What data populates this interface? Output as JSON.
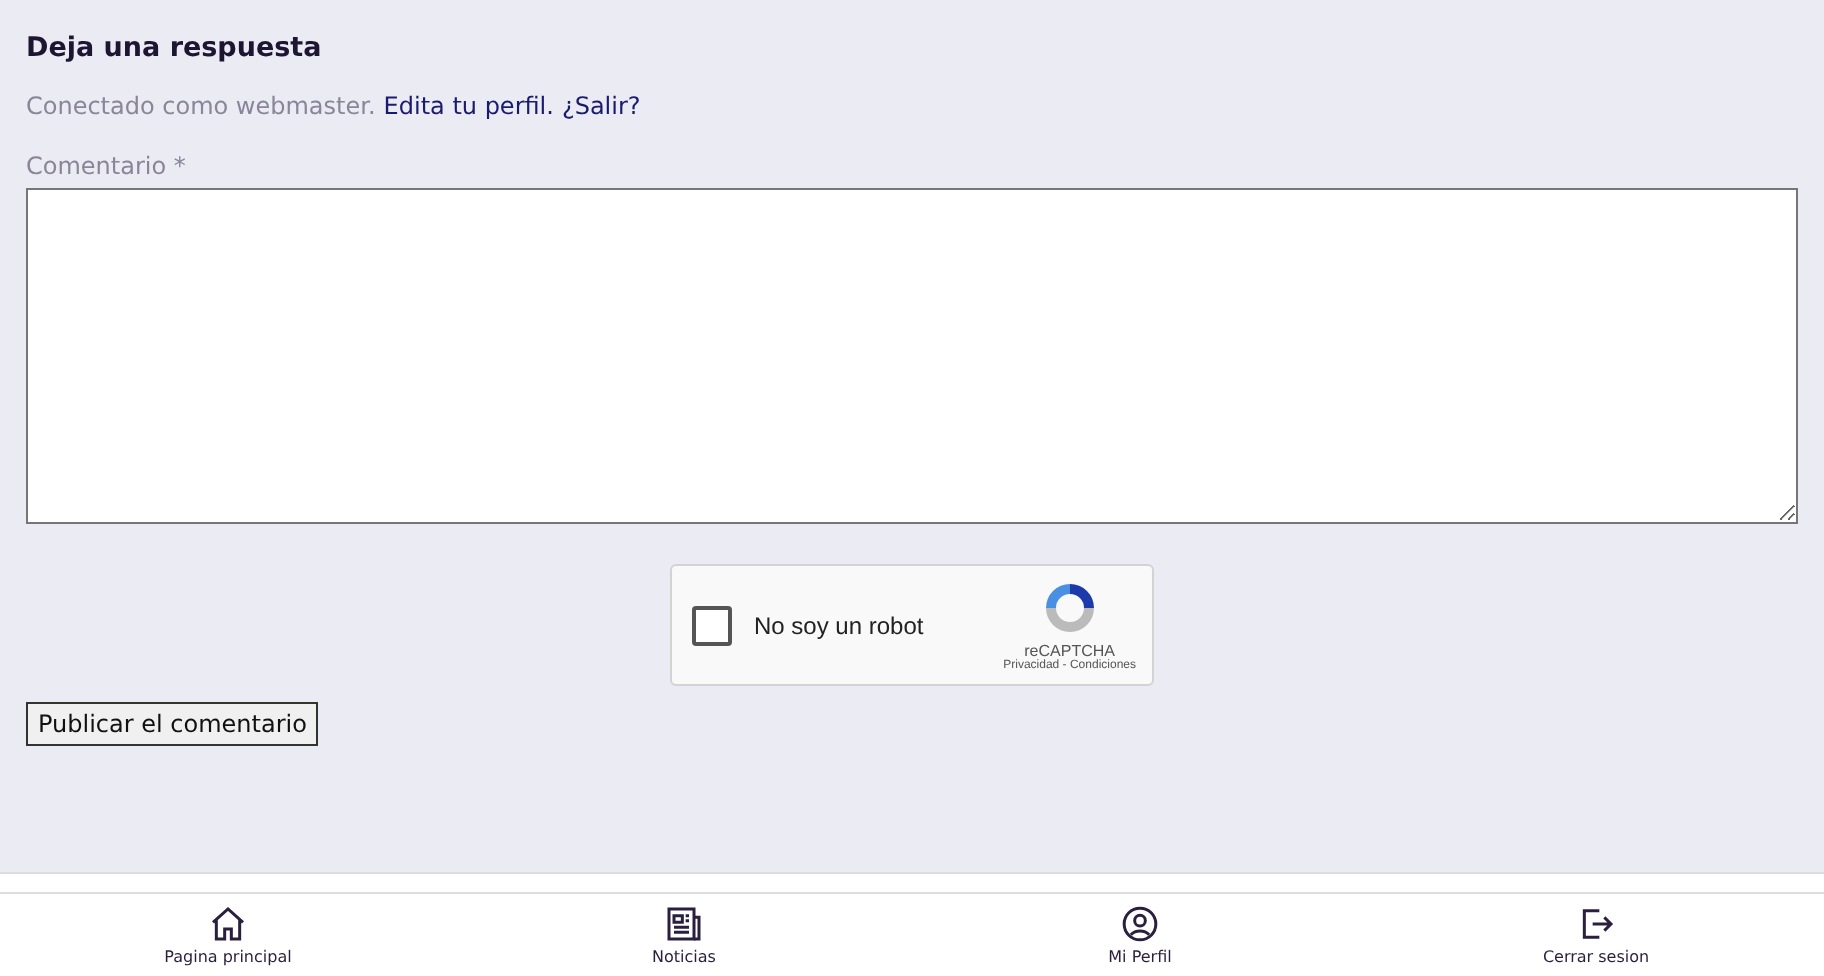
{
  "heading": "Deja una respuesta",
  "logged_in": {
    "text": "Conectado como webmaster.",
    "links": [
      "Edita tu perfil.",
      "¿Salir?"
    ]
  },
  "comment": {
    "label": "Comentario *"
  },
  "captcha": {
    "checked": false,
    "label": "No soy un robot",
    "brand": "reCAPTCHA",
    "terms": "Privacidad - Condiciones"
  },
  "submit": "Publicar el comentario",
  "nav": [
    {
      "kind": "home",
      "label": "Pagina principal"
    },
    {
      "kind": "news",
      "label": "Noticias"
    },
    {
      "kind": "profile",
      "label": "Mi Perfil"
    },
    {
      "kind": "logout",
      "label": "Cerrar sesion"
    }
  ]
}
